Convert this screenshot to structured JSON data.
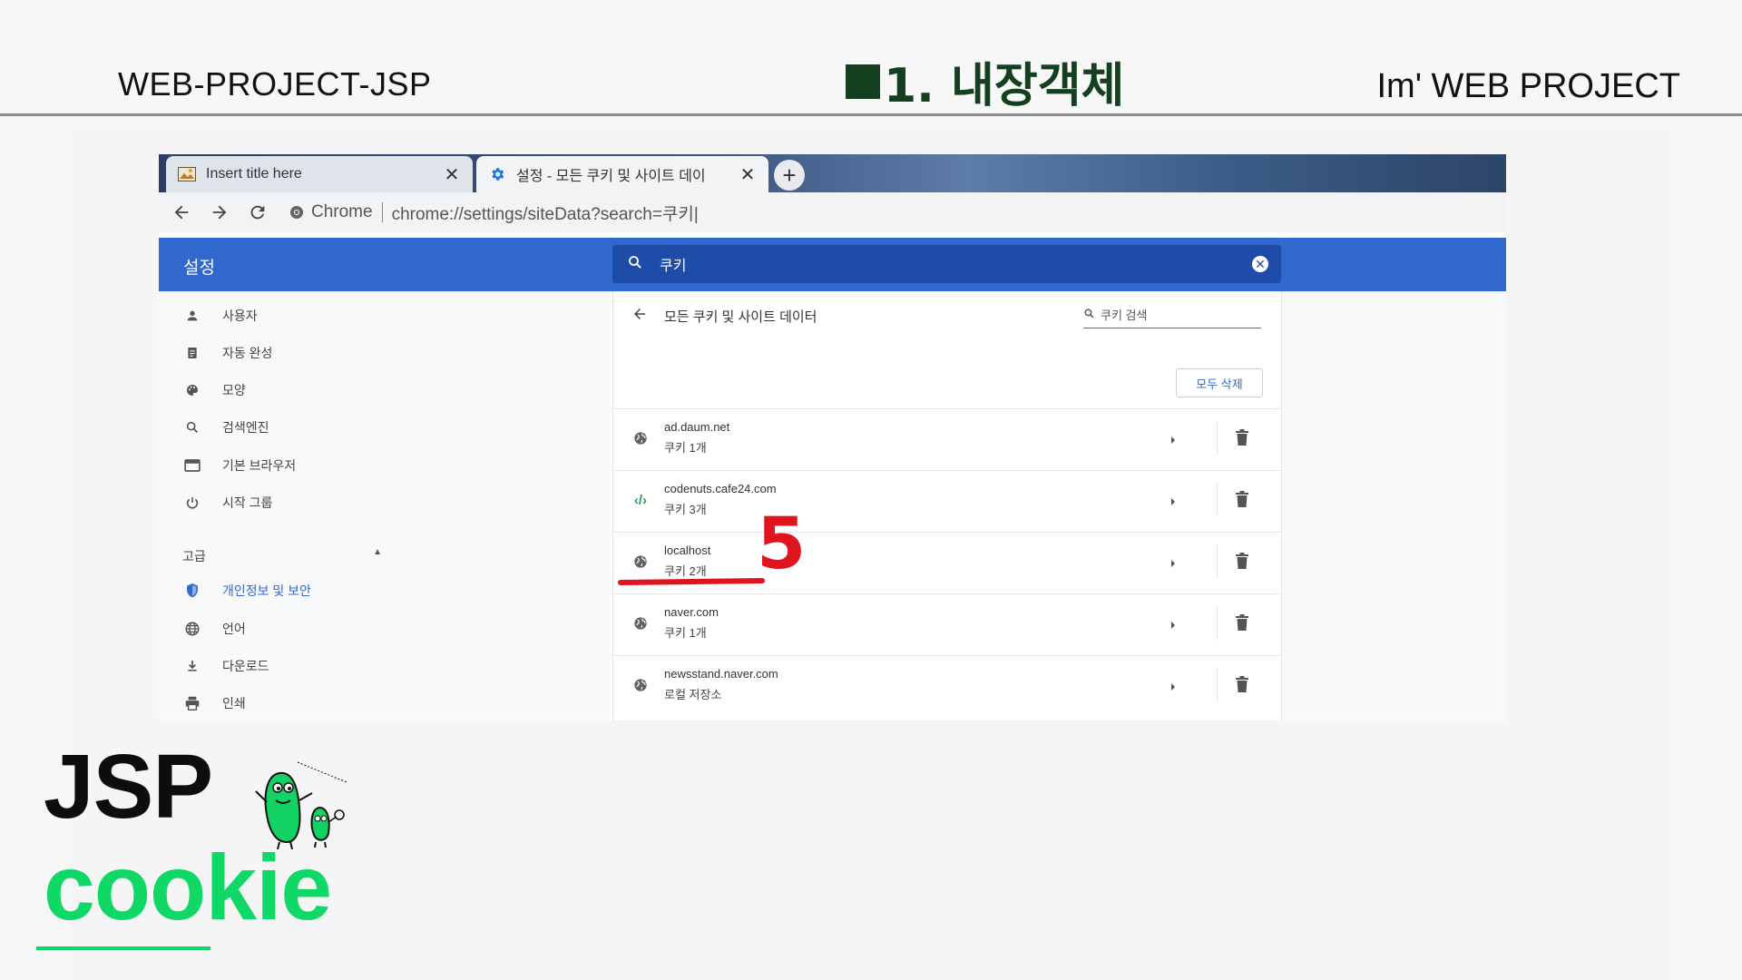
{
  "slide": {
    "left_title": "WEB-PROJECT-JSP",
    "center_title": "1. 내장객체",
    "right_title": "Im'  WEB PROJECT",
    "brand_main": "JSP",
    "brand_sub": "cookie"
  },
  "browser": {
    "tabs": [
      {
        "label": "Insert title here",
        "icon": "page-thumbnail-icon",
        "active": false
      },
      {
        "label": "설정 - 모든 쿠키 및 사이트 데이",
        "icon": "gear-icon",
        "active": true
      }
    ],
    "toolbar": {
      "site_chip": "Chrome",
      "url": "chrome://settings/siteData?search=쿠키|"
    }
  },
  "settings": {
    "title": "설정",
    "search_query": "쿠키",
    "sidebar": [
      {
        "label": "사용자",
        "icon": "person-icon"
      },
      {
        "label": "자동 완성",
        "icon": "clipboard-icon"
      },
      {
        "label": "모양",
        "icon": "palette-icon"
      },
      {
        "label": "검색엔진",
        "icon": "search-icon"
      },
      {
        "label": "기본 브라우저",
        "icon": "browser-window-icon"
      },
      {
        "label": "시작 그룹",
        "icon": "power-icon"
      }
    ],
    "advanced_label": "고급",
    "advanced_items": [
      {
        "label": "개인정보 및 보안",
        "icon": "shield-icon",
        "active": true
      },
      {
        "label": "언어",
        "icon": "globe-icon"
      },
      {
        "label": "다운로드",
        "icon": "download-icon"
      },
      {
        "label": "인쇄",
        "icon": "printer-icon"
      }
    ],
    "content": {
      "heading": "모든 쿠키 및 사이트 데이터",
      "search_placeholder": "쿠키 검색",
      "delete_all": "모두 삭제",
      "sites": [
        {
          "name": "ad.daum.net",
          "detail": "쿠키 1개",
          "icon": "globe-icon"
        },
        {
          "name": "codenuts.cafe24.com",
          "detail": "쿠키 3개",
          "icon": "code-brackets-icon"
        },
        {
          "name": "localhost",
          "detail": "쿠키 2개",
          "icon": "globe-icon"
        },
        {
          "name": "naver.com",
          "detail": "쿠키 1개",
          "icon": "globe-icon"
        },
        {
          "name": "newsstand.naver.com",
          "detail": "로컬 저장소",
          "icon": "globe-icon"
        }
      ]
    },
    "annotation": "5"
  },
  "colors": {
    "header_green": "#14401f",
    "brand_green": "#10d866",
    "settings_blue": "#3168cd",
    "annotation_red": "#e0141e"
  }
}
